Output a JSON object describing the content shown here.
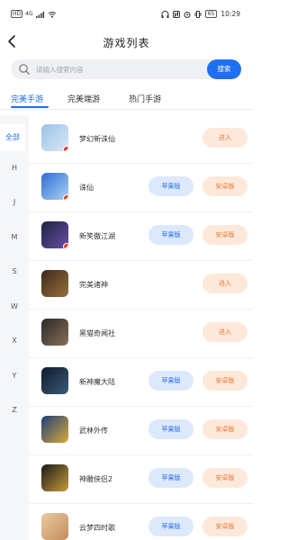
{
  "statusbar": {
    "left_badge": "HD",
    "network": "4G",
    "time": "10:29",
    "battery": "65"
  },
  "navbar": {
    "title": "游戏列表"
  },
  "search": {
    "placeholder": "请输入搜索内容",
    "button_label": "搜索"
  },
  "tabs": [
    {
      "label": "完美手游"
    },
    {
      "label": "完美端游"
    },
    {
      "label": "热门手游"
    }
  ],
  "index_letters": [
    "全部",
    "H",
    "J",
    "M",
    "S",
    "W",
    "X",
    "Y",
    "Z"
  ],
  "buttons": {
    "enter": "进入",
    "apple": "苹果版",
    "android": "安卓版"
  },
  "games": [
    {
      "name": "梦幻新诛仙",
      "icon": "mhxzx-icon",
      "colors": [
        "#9bc2e8",
        "#d9e9f6"
      ]
    },
    {
      "name": "诛仙",
      "icon": "zhuxian-icon",
      "colors": [
        "#2f6ccf",
        "#a9d3f5"
      ]
    },
    {
      "name": "新笑傲江湖",
      "icon": "xxajh-icon",
      "colors": [
        "#1a2440",
        "#6a4ea8"
      ]
    },
    {
      "name": "完美诸神",
      "icon": "wmzs-icon",
      "colors": [
        "#3a2a1d",
        "#9a6e3a"
      ]
    },
    {
      "name": "黑猫奇闻社",
      "icon": "hmqws-icon",
      "colors": [
        "#2a2a2a",
        "#8a6d55"
      ]
    },
    {
      "name": "新神魔大陆",
      "icon": "xsmdl-icon",
      "colors": [
        "#0e1b2a",
        "#3b5a78"
      ]
    },
    {
      "name": "武林外传",
      "icon": "wlwz-icon",
      "colors": [
        "#1e3f7a",
        "#d9a93a"
      ]
    },
    {
      "name": "神雕侠侣2",
      "icon": "sdxl2-icon",
      "colors": [
        "#1a1a1a",
        "#c79a3a"
      ]
    },
    {
      "name": "云梦四时歌",
      "icon": "ymssg-icon",
      "colors": [
        "#e9cba0",
        "#c58a5a"
      ]
    }
  ],
  "accent_color": "#1f6ff0",
  "apple_btn_color": "#dce8fc",
  "android_btn_color": "#fde8da"
}
